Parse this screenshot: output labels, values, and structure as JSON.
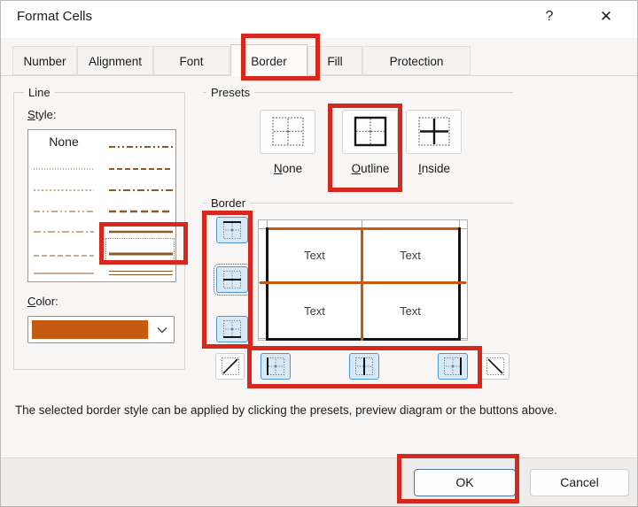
{
  "window": {
    "title": "Format Cells",
    "help_glyph": "?",
    "close_glyph": "✕"
  },
  "tabs": [
    {
      "label": "Number",
      "selected": false
    },
    {
      "label": "Alignment",
      "selected": false
    },
    {
      "label": "Font",
      "selected": false
    },
    {
      "label": "Border",
      "selected": true
    },
    {
      "label": "Fill",
      "selected": false
    },
    {
      "label": "Protection",
      "selected": false
    }
  ],
  "line_group": {
    "group_label": "Line",
    "style_label": {
      "u": "S",
      "rest": "tyle:"
    },
    "none_item": "None",
    "styles_left": [
      "dot-fine",
      "dot",
      "dash-dot-dot",
      "dash-dot",
      "dash",
      "solid-thin"
    ],
    "styles_right": [
      "dash-dot-dot-md",
      "dash-md",
      "dash-dot-md",
      "dash-lg-md",
      "solid-md",
      "solid-selected",
      "double"
    ],
    "selected_style": "solid-selected",
    "color_label": {
      "u": "C",
      "rest": "olor:"
    },
    "color_value": "#C55A11"
  },
  "presets_group": {
    "group_label": "Presets",
    "items": [
      {
        "label": {
          "u": "N",
          "rest": "one"
        },
        "icon": "border-none-icon"
      },
      {
        "label": {
          "u": "O",
          "rest": "utline"
        },
        "icon": "border-outline-icon",
        "annotated": true
      },
      {
        "label": {
          "u": "I",
          "rest": "nside"
        },
        "icon": "border-inside-icon"
      }
    ]
  },
  "border_group": {
    "group_label": "Border",
    "cell_text": "Text",
    "toggled_buttons": [
      "top",
      "middle-horizontal",
      "bottom",
      "left",
      "middle-vertical",
      "right"
    ],
    "untoggled_buttons": [
      "diagonal-up",
      "diagonal-down"
    ]
  },
  "helper_text": "The selected border style can be applied by clicking the presets, preview diagram or the buttons above.",
  "footer": {
    "ok_label": "OK",
    "cancel_label": "Cancel"
  },
  "colors": {
    "annotation_red": "#d7281d",
    "accent_orange": "#C55A11",
    "line_brown": "#8B5A2B",
    "toggle_blue_bg": "#d7e9f7",
    "toggle_blue_border": "#4e94ce",
    "preview_black": "#141414"
  }
}
